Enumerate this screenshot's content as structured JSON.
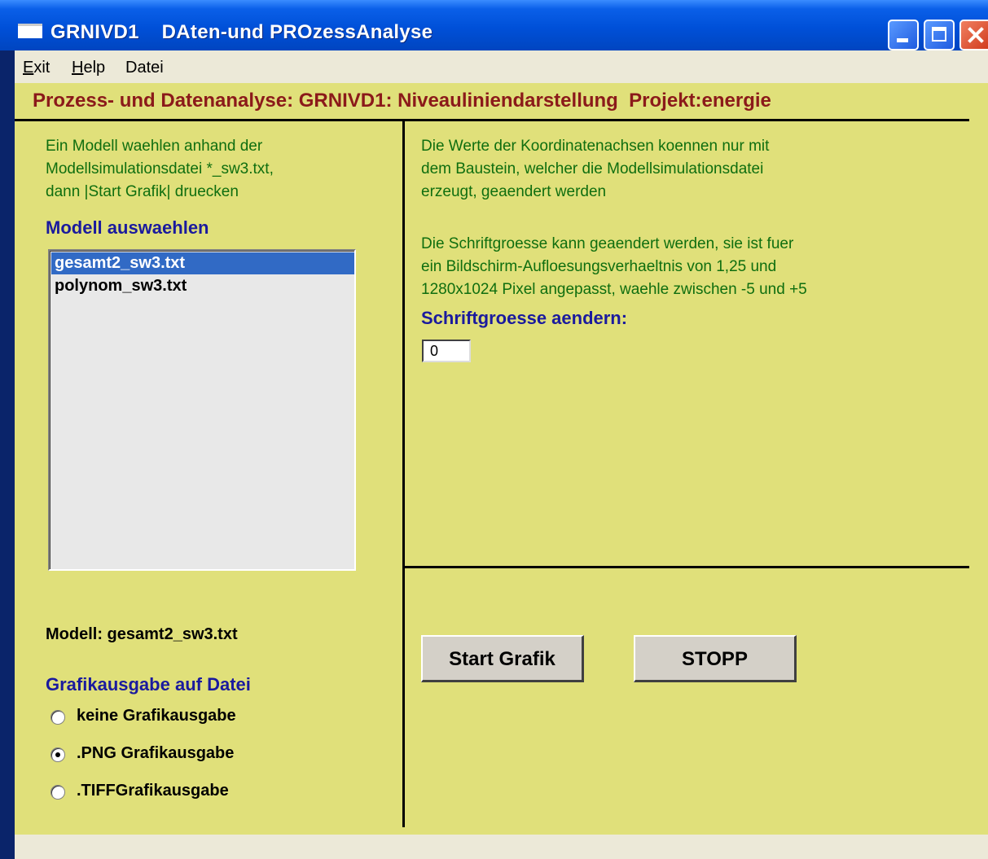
{
  "window": {
    "title": "GRNIVD1    DAten-und PROzessAnalyse"
  },
  "menu": {
    "items": [
      {
        "label": "Exit",
        "accel": "E"
      },
      {
        "label": "Help",
        "accel": "H"
      },
      {
        "label": "Datei",
        "accel": ""
      }
    ]
  },
  "header": {
    "title": "Prozess- und Datenanalyse: GRNIVD1: Niveauliniendarstellung  Projekt:energie"
  },
  "left": {
    "instructions": [
      "Ein Modell waehlen anhand der",
      "Modellsimulationsdatei *_sw3.txt,",
      "dann  |Start Grafik|  druecken"
    ],
    "list_heading": "Modell auswaehlen",
    "models": [
      {
        "name": "gesamt2_sw3.txt",
        "selected": true
      },
      {
        "name": "polynom_sw3.txt",
        "selected": false
      }
    ],
    "current_model": "Modell: gesamt2_sw3.txt",
    "output_heading": "Grafikausgabe auf Datei",
    "output_options": [
      {
        "label": "keine Grafikausgabe",
        "checked": false
      },
      {
        "label": ".PNG Grafikausgabe",
        "checked": true
      },
      {
        "label": ".TIFFGrafikausgabe",
        "checked": false
      }
    ]
  },
  "right": {
    "info1": [
      "Die Werte der Koordinatenachsen koennen nur mit",
      "dem Baustein, welcher die Modellsimulationsdatei",
      "erzeugt, geaendert werden"
    ],
    "info2": [
      "Die Schriftgroesse kann geaendert werden, sie ist fuer",
      "ein Bildschirm-Aufloesungsverhaeltnis von 1,25 und",
      "1280x1024 Pixel angepasst, waehle zwischen -5 und +5"
    ],
    "font_heading": "Schriftgroesse aendern:",
    "font_value": "0",
    "start_button": "Start Grafik",
    "stop_button": "STOPP"
  }
}
